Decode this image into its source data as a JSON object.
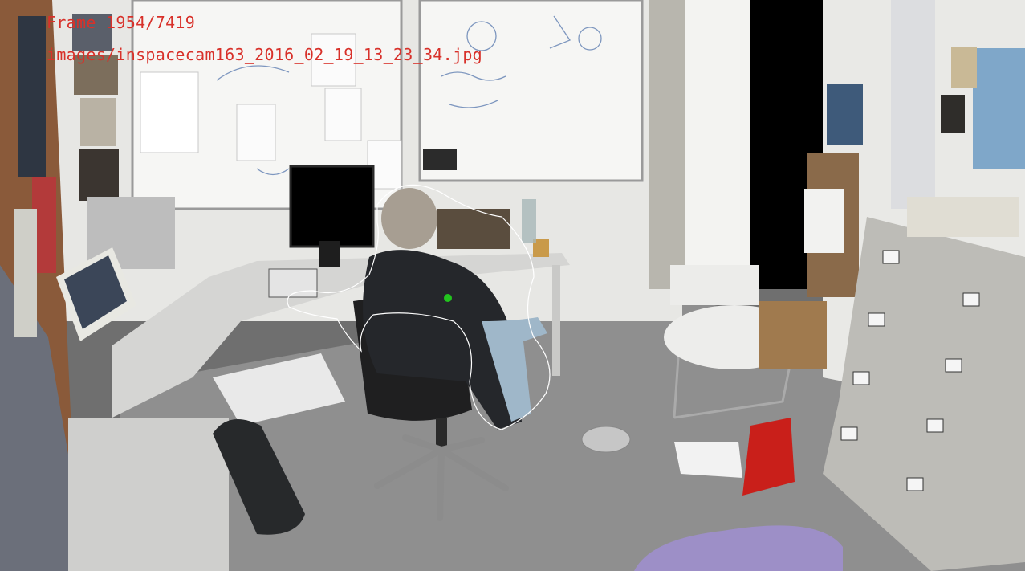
{
  "overlay": {
    "frame_label": "Frame 1954/7419",
    "image_path": "images/inspacecam163_2016_02_19_13_23_34.jpg",
    "text_color": "#d8312a"
  },
  "scene": {
    "description_tags": [
      "office",
      "whiteboard",
      "desk",
      "person-seated",
      "office-chair",
      "filing-cabinet",
      "round-table",
      "window",
      "monitor"
    ],
    "marker_color": "#22c41e",
    "contour_color": "#ffffff"
  }
}
